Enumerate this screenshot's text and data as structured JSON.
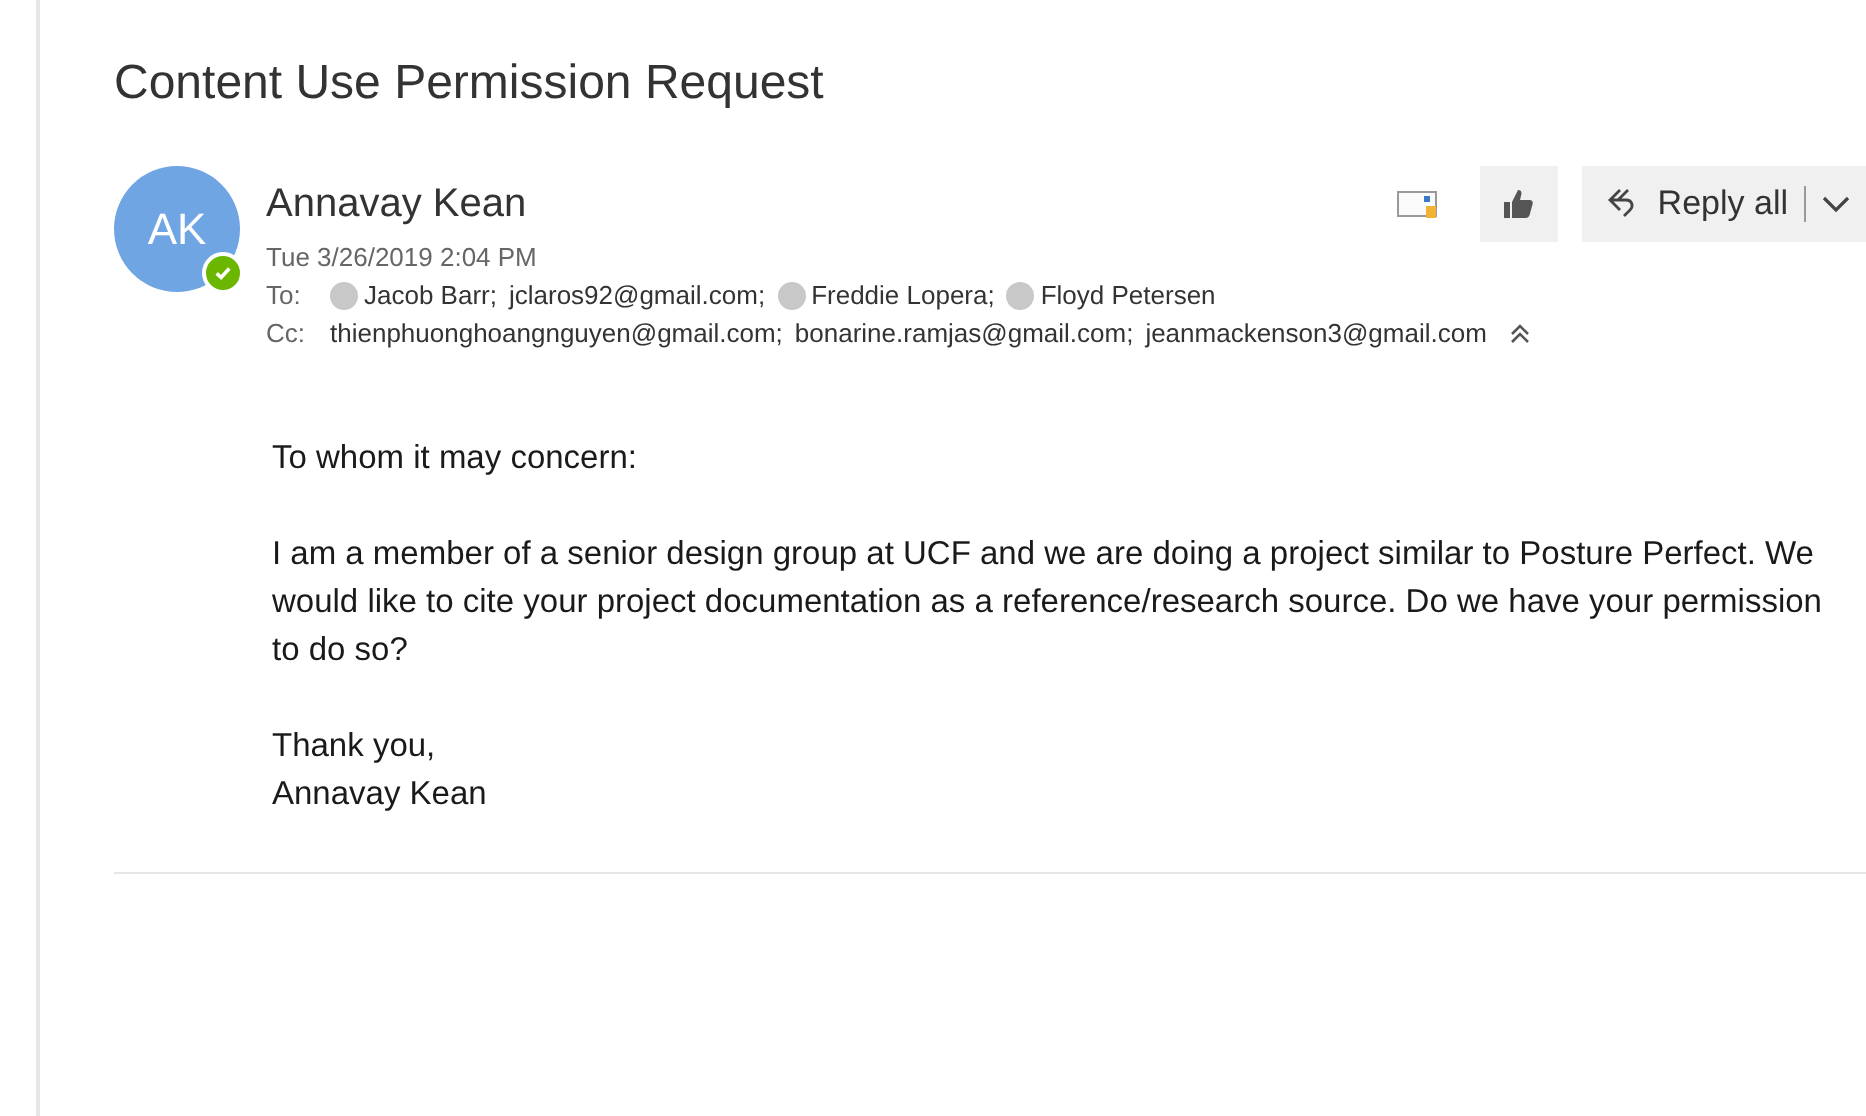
{
  "subject": "Content Use Permission Request",
  "sender": {
    "initials": "AK",
    "name": "Annavay Kean",
    "online": true,
    "date": "Tue 3/26/2019 2:04 PM"
  },
  "actions": {
    "reply_label": "Reply all"
  },
  "to": {
    "label": "To:",
    "recipients": [
      {
        "name": "Jacob Barr;",
        "avatar": true
      },
      {
        "name": "jclaros92@gmail.com;",
        "avatar": false
      },
      {
        "name": "Freddie Lopera;",
        "avatar": true
      },
      {
        "name": "Floyd Petersen",
        "avatar": true
      }
    ]
  },
  "cc": {
    "label": "Cc:",
    "recipients": [
      {
        "name": "thienphuonghoangnguyen@gmail.com;",
        "avatar": false
      },
      {
        "name": "bonarine.ramjas@gmail.com;",
        "avatar": false
      },
      {
        "name": "jeanmackenson3@gmail.com",
        "avatar": false
      }
    ],
    "expanded": true
  },
  "body": [
    [
      "To whom it may concern:"
    ],
    [
      "I am a member of a senior design group at UCF and we are doing a project similar to Posture Perfect. We would like to cite your project documentation as a reference/research source. Do we have your permission to do so?"
    ],
    [
      "Thank you,",
      "Annavay Kean"
    ]
  ]
}
